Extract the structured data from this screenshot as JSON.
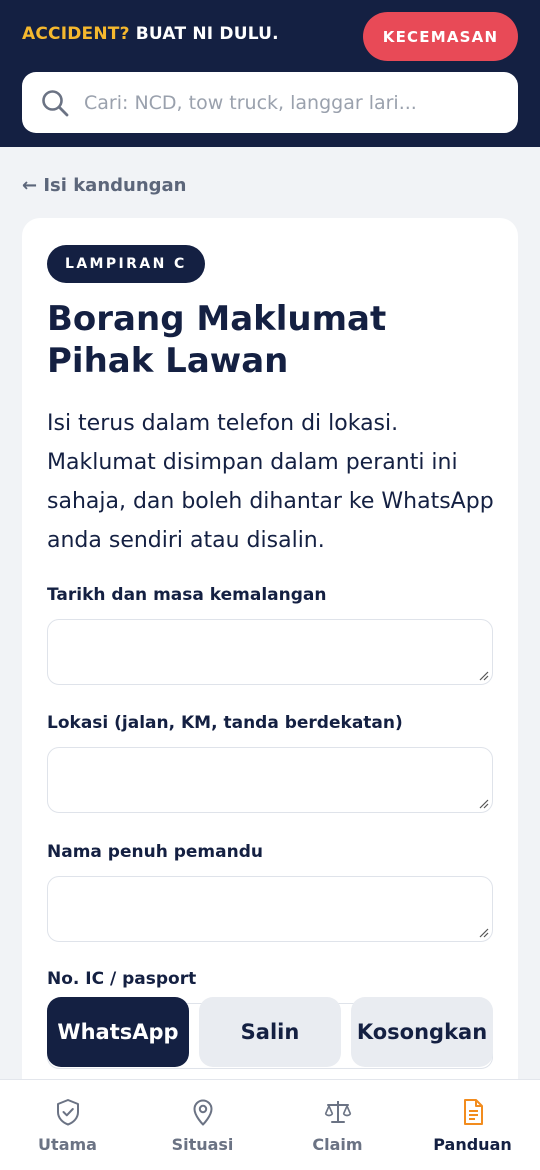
{
  "header": {
    "brand_accent": "ACCIDENT?",
    "brand_rest": " BUAT NI DULU.",
    "emergency_label": "KECEMASAN",
    "accent_color": "#f5b82e",
    "emergency_color": "#e84a57"
  },
  "search": {
    "placeholder": "Cari: NCD, tow truck, langgar lari...",
    "value": "",
    "icon": "search-icon"
  },
  "nav": {
    "back_label": "← Isi kandungan"
  },
  "form": {
    "badge": "LAMPIRAN C",
    "title": "Borang Maklumat Pihak Lawan",
    "intro": "Isi terus dalam telefon di lokasi. Maklumat disimpan dalam peranti ini sahaja, dan boleh dihantar ke WhatsApp anda sendiri atau disalin.",
    "fields": [
      {
        "label": "Tarikh dan masa kemalangan",
        "value": ""
      },
      {
        "label": "Lokasi (jalan, KM, tanda berdekatan)",
        "value": ""
      },
      {
        "label": "Nama penuh pemandu",
        "value": ""
      },
      {
        "label": "No. IC / pasport",
        "value": ""
      }
    ],
    "actions": {
      "whatsapp": "WhatsApp",
      "copy": "Salin",
      "clear": "Kosongkan"
    }
  },
  "tabbar": {
    "items": [
      {
        "label": "Utama",
        "icon": "shield-check-icon"
      },
      {
        "label": "Situasi",
        "icon": "map-pin-icon"
      },
      {
        "label": "Claim",
        "icon": "scale-icon"
      },
      {
        "label": "Panduan",
        "icon": "document-icon",
        "active": true
      }
    ],
    "active_color": "#f28c1e"
  }
}
